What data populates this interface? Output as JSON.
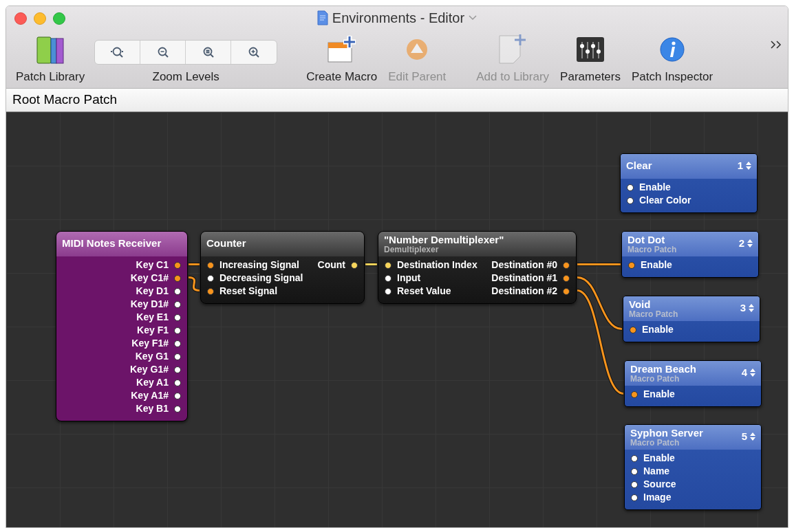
{
  "window": {
    "title": "Environments - Editor"
  },
  "toolbar": [
    {
      "kind": "library",
      "label": "Patch Library",
      "disabled": false
    },
    {
      "kind": "zoom",
      "label": "Zoom Levels",
      "disabled": false
    },
    {
      "kind": "create",
      "label": "Create Macro",
      "disabled": false
    },
    {
      "kind": "parent",
      "label": "Edit Parent",
      "disabled": true
    },
    {
      "kind": "add",
      "label": "Add to Library",
      "disabled": true
    },
    {
      "kind": "parameters",
      "label": "Parameters",
      "disabled": false
    },
    {
      "kind": "inspector",
      "label": "Patch Inspector",
      "disabled": false
    }
  ],
  "path_bar": "Root Macro Patch",
  "nodes": [
    {
      "kind": "midi",
      "title": "MIDI Notes Receiver",
      "outputs": [
        {
          "label": "Key C1",
          "color": "#f7941d"
        },
        {
          "label": "Key C1#",
          "color": "#f7941d"
        },
        {
          "label": "Key D1",
          "color": "#ffffff"
        },
        {
          "label": "Key D1#",
          "color": "#ffffff"
        },
        {
          "label": "Key E1",
          "color": "#ffffff"
        },
        {
          "label": "Key F1",
          "color": "#ffffff"
        },
        {
          "label": "Key F1#",
          "color": "#ffffff"
        },
        {
          "label": "Key G1",
          "color": "#ffffff"
        },
        {
          "label": "Key G1#",
          "color": "#ffffff"
        },
        {
          "label": "Key A1",
          "color": "#ffffff"
        },
        {
          "label": "Key A1#",
          "color": "#ffffff"
        },
        {
          "label": "Key B1",
          "color": "#ffffff"
        }
      ]
    },
    {
      "kind": "processor",
      "title": "Counter",
      "inputs": [
        {
          "label": "Increasing Signal",
          "color": "#f7941d"
        },
        {
          "label": "Decreasing Signal",
          "color": "#ffffff"
        },
        {
          "label": "Reset Signal",
          "color": "#f7941d"
        }
      ],
      "outputs": [
        {
          "label": "Count",
          "color": "#f6d55c"
        }
      ]
    },
    {
      "kind": "processor",
      "title": "\"Number Demultiplexer\"",
      "subtitle": "Demultiplexer",
      "inputs": [
        {
          "label": "Destination Index",
          "color": "#f6d55c"
        },
        {
          "label": "Input",
          "color": "#ffffff"
        },
        {
          "label": "Reset Value",
          "color": "#ffffff"
        }
      ],
      "outputs": [
        {
          "label": "Destination #0",
          "color": "#f7941d"
        },
        {
          "label": "Destination #1",
          "color": "#f7941d"
        },
        {
          "label": "Destination #2",
          "color": "#f7941d"
        }
      ]
    },
    {
      "kind": "consumer",
      "title": "Clear",
      "number": "1",
      "inputs": [
        {
          "label": "Enable",
          "color": "#ffffff"
        },
        {
          "label": "Clear Color",
          "color": "#ffffff"
        }
      ]
    },
    {
      "kind": "consumer",
      "title": "Dot Dot",
      "subtitle": "Macro Patch",
      "number": "2",
      "inputs": [
        {
          "label": "Enable",
          "color": "#f7941d"
        }
      ]
    },
    {
      "kind": "consumer",
      "title": "Void",
      "subtitle": "Macro Patch",
      "number": "3",
      "inputs": [
        {
          "label": "Enable",
          "color": "#f7941d"
        }
      ]
    },
    {
      "kind": "consumer",
      "title": "Dream Beach",
      "subtitle": "Macro Patch",
      "number": "4",
      "inputs": [
        {
          "label": "Enable",
          "color": "#f7941d"
        }
      ]
    },
    {
      "kind": "consumer",
      "title": "Syphon Server",
      "subtitle": "Macro Patch",
      "number": "5",
      "inputs": [
        {
          "label": "Enable",
          "color": "#ffffff"
        },
        {
          "label": "Name",
          "color": "#ffffff"
        },
        {
          "label": "Source",
          "color": "#ffffff"
        },
        {
          "label": "Image",
          "color": "#ffffff"
        }
      ]
    }
  ]
}
